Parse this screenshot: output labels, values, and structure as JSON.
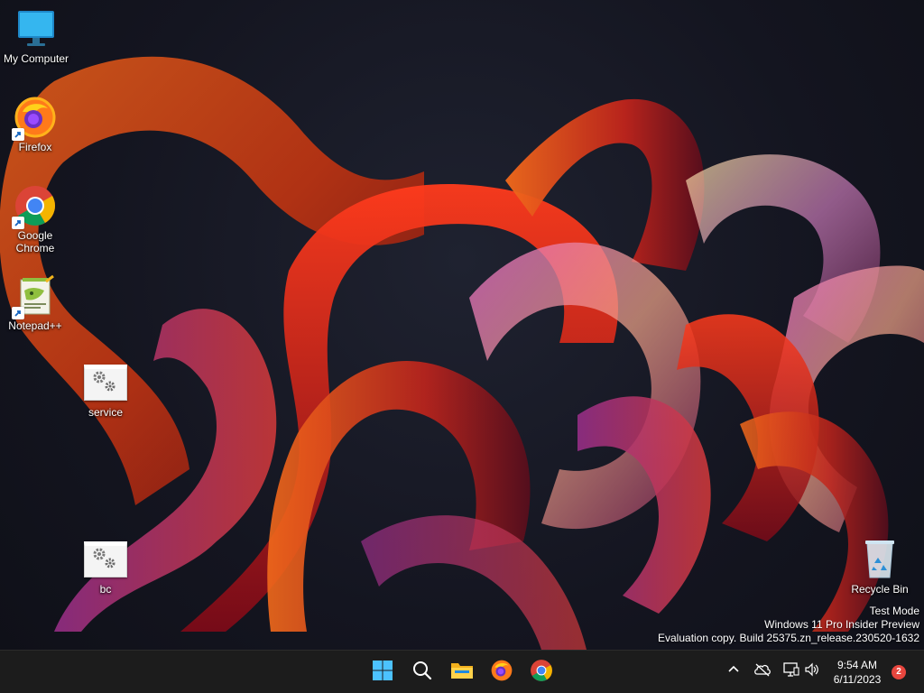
{
  "desktop": {
    "icons": [
      {
        "label": "My Computer",
        "icon": "monitor-icon",
        "shortcut": false
      },
      {
        "label": "Firefox",
        "icon": "firefox-icon",
        "shortcut": true
      },
      {
        "label": "Google Chrome",
        "icon": "chrome-icon",
        "shortcut": true
      },
      {
        "label": "Notepad++",
        "icon": "notepadpp-icon",
        "shortcut": true
      },
      {
        "label": "service",
        "icon": "settings-file-icon",
        "shortcut": false
      },
      {
        "label": "bc",
        "icon": "settings-file-icon",
        "shortcut": false
      },
      {
        "label": "Recycle Bin",
        "icon": "recycle-bin-icon",
        "shortcut": false
      }
    ],
    "watermark": {
      "line1": "Test Mode",
      "line2": "Windows 11 Pro Insider Preview",
      "line3": "Evaluation copy. Build 25375.zn_release.230520-1632"
    }
  },
  "taskbar": {
    "background": "#1c1c1c",
    "pinned": [
      {
        "name": "start-button",
        "icon": "windows-logo-icon"
      },
      {
        "name": "search-button",
        "icon": "search-icon"
      },
      {
        "name": "file-explorer-button",
        "icon": "folder-icon"
      },
      {
        "name": "firefox-taskbar-button",
        "icon": "firefox-icon"
      },
      {
        "name": "chrome-taskbar-button",
        "icon": "chrome-icon"
      }
    ],
    "tray": {
      "icons": [
        "chevron-up-icon",
        "cloud-offline-icon",
        "network-icon",
        "volume-icon"
      ],
      "time": "9:54 AM",
      "date": "6/11/2023",
      "notification_count": "2"
    }
  },
  "colors": {
    "accent": "#0078d4",
    "badge": "#e8463e"
  }
}
